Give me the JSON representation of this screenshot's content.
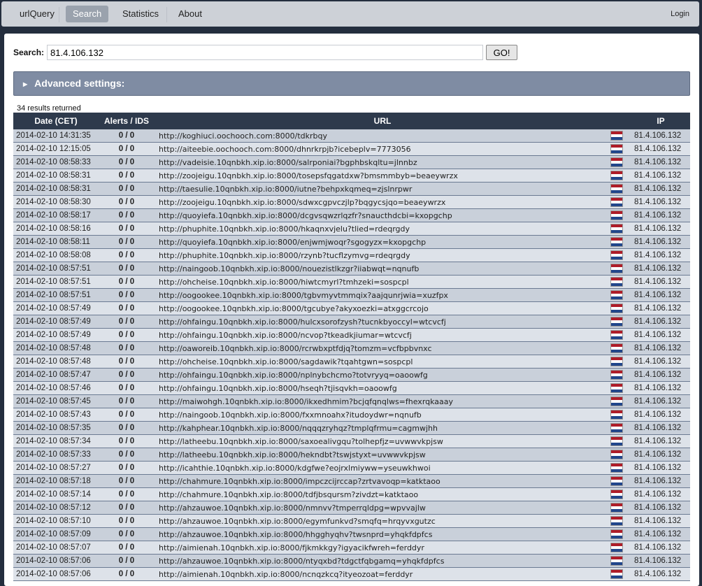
{
  "nav": {
    "brand": "urlQuery",
    "search": "Search",
    "statistics": "Statistics",
    "about": "About",
    "login": "Login"
  },
  "search": {
    "label": "Search:",
    "value": "81.4.106.132",
    "go": "GO!"
  },
  "advanced": {
    "label": "Advanced settings:"
  },
  "results_count": "34 results returned",
  "columns": [
    "Date (CET)",
    "Alerts / IDS",
    "URL",
    "IP"
  ],
  "flag_colors": [
    "#ae1c28",
    "#ffffff",
    "#21468b"
  ],
  "rows": [
    {
      "date": "2014-02-10 14:31:35",
      "alerts": "0 / 0",
      "url": "http://koghiuci.oochooch.com:8000/tdkrbqy",
      "ip": "81.4.106.132"
    },
    {
      "date": "2014-02-10 12:15:05",
      "alerts": "0 / 0",
      "url": "http://aiteebie.oochooch.com:8000/dhnrkrpjb?icebeplv=7773056",
      "ip": "81.4.106.132"
    },
    {
      "date": "2014-02-10 08:58:33",
      "alerts": "0 / 0",
      "url": "http://vadeisie.10qnbkh.xip.io:8000/salrponiai?bgphbskqltu=jlnnbz",
      "ip": "81.4.106.132"
    },
    {
      "date": "2014-02-10 08:58:31",
      "alerts": "0 / 0",
      "url": "http://zoojeigu.10qnbkh.xip.io:8000/tosepsfqgatdxw?bmsmmbyb=beaeywrzx",
      "ip": "81.4.106.132"
    },
    {
      "date": "2014-02-10 08:58:31",
      "alerts": "0 / 0",
      "url": "http://taesulie.10qnbkh.xip.io:8000/iutne?behpxkqmeq=zjslnrpwr",
      "ip": "81.4.106.132"
    },
    {
      "date": "2014-02-10 08:58:30",
      "alerts": "0 / 0",
      "url": "http://zoojeigu.10qnbkh.xip.io:8000/sdwxcgpvczjlp?bqgycsjqo=beaeywrzx",
      "ip": "81.4.106.132"
    },
    {
      "date": "2014-02-10 08:58:17",
      "alerts": "0 / 0",
      "url": "http://quoyiefa.10qnbkh.xip.io:8000/dcgvsqwzrlqzfr?snaucthdcbi=kxopgchp",
      "ip": "81.4.106.132"
    },
    {
      "date": "2014-02-10 08:58:16",
      "alerts": "0 / 0",
      "url": "http://phuphite.10qnbkh.xip.io:8000/hkaqnxvjelu?tlied=rdeqrgdy",
      "ip": "81.4.106.132"
    },
    {
      "date": "2014-02-10 08:58:11",
      "alerts": "0 / 0",
      "url": "http://quoyiefa.10qnbkh.xip.io:8000/enjwmjwoqr?sgogyzx=kxopgchp",
      "ip": "81.4.106.132"
    },
    {
      "date": "2014-02-10 08:58:08",
      "alerts": "0 / 0",
      "url": "http://phuphite.10qnbkh.xip.io:8000/rzynb?tucflzymvg=rdeqrgdy",
      "ip": "81.4.106.132"
    },
    {
      "date": "2014-02-10 08:57:51",
      "alerts": "0 / 0",
      "url": "http://naingoob.10qnbkh.xip.io:8000/nouezistlkzgr?iiabwqt=nqnufb",
      "ip": "81.4.106.132"
    },
    {
      "date": "2014-02-10 08:57:51",
      "alerts": "0 / 0",
      "url": "http://ohcheise.10qnbkh.xip.io:8000/hiwtcmyrl?tmhzeki=sospcpl",
      "ip": "81.4.106.132"
    },
    {
      "date": "2014-02-10 08:57:51",
      "alerts": "0 / 0",
      "url": "http://oogookee.10qnbkh.xip.io:8000/tgbvmyvtmmqix?aajqunrjwia=xuzfpx",
      "ip": "81.4.106.132"
    },
    {
      "date": "2014-02-10 08:57:49",
      "alerts": "0 / 0",
      "url": "http://oogookee.10qnbkh.xip.io:8000/tgcubye?akyxoezki=atxggcrcojo",
      "ip": "81.4.106.132"
    },
    {
      "date": "2014-02-10 08:57:49",
      "alerts": "0 / 0",
      "url": "http://ohfaingu.10qnbkh.xip.io:8000/hulcxsorofzysh?tucnkbyoccyl=wtcvcfj",
      "ip": "81.4.106.132"
    },
    {
      "date": "2014-02-10 08:57:49",
      "alerts": "0 / 0",
      "url": "http://ohfaingu.10qnbkh.xip.io:8000/ncvop?tkeadkjiumar=wtcvcfj",
      "ip": "81.4.106.132"
    },
    {
      "date": "2014-02-10 08:57:48",
      "alerts": "0 / 0",
      "url": "http://oaworeib.10qnbkh.xip.io:8000/rcrwbxptfdjq?tomzm=vcfbpbvnxc",
      "ip": "81.4.106.132"
    },
    {
      "date": "2014-02-10 08:57:48",
      "alerts": "0 / 0",
      "url": "http://ohcheise.10qnbkh.xip.io:8000/sagdawik?tqahtgwn=sospcpl",
      "ip": "81.4.106.132"
    },
    {
      "date": "2014-02-10 08:57:47",
      "alerts": "0 / 0",
      "url": "http://ohfaingu.10qnbkh.xip.io:8000/nplnybchcmo?totvryyq=oaoowfg",
      "ip": "81.4.106.132"
    },
    {
      "date": "2014-02-10 08:57:46",
      "alerts": "0 / 0",
      "url": "http://ohfaingu.10qnbkh.xip.io:8000/hseqh?tjisqvkh=oaoowfg",
      "ip": "81.4.106.132"
    },
    {
      "date": "2014-02-10 08:57:45",
      "alerts": "0 / 0",
      "url": "http://maiwohgh.10qnbkh.xip.io:8000/ikxedhmim?bcjqfqnqlws=fhexrqkaaay",
      "ip": "81.4.106.132"
    },
    {
      "date": "2014-02-10 08:57:43",
      "alerts": "0 / 0",
      "url": "http://naingoob.10qnbkh.xip.io:8000/fxxmnoahx?itudoydwr=nqnufb",
      "ip": "81.4.106.132"
    },
    {
      "date": "2014-02-10 08:57:35",
      "alerts": "0 / 0",
      "url": "http://kahphear.10qnbkh.xip.io:8000/nqqqzryhqz?tmplqfrmu=cagmwjhh",
      "ip": "81.4.106.132"
    },
    {
      "date": "2014-02-10 08:57:34",
      "alerts": "0 / 0",
      "url": "http://latheebu.10qnbkh.xip.io:8000/saxoealivgqu?tolhepfjz=uvwwvkpjsw",
      "ip": "81.4.106.132"
    },
    {
      "date": "2014-02-10 08:57:33",
      "alerts": "0 / 0",
      "url": "http://latheebu.10qnbkh.xip.io:8000/hekndbt?tswjstyxt=uvwwvkpjsw",
      "ip": "81.4.106.132"
    },
    {
      "date": "2014-02-10 08:57:27",
      "alerts": "0 / 0",
      "url": "http://icahthie.10qnbkh.xip.io:8000/kdgfwe?eojrxlmiyww=yseuwkhwoi",
      "ip": "81.4.106.132"
    },
    {
      "date": "2014-02-10 08:57:18",
      "alerts": "0 / 0",
      "url": "http://chahmure.10qnbkh.xip.io:8000/impczcijrccap?zrtvavoqp=katktaoo",
      "ip": "81.4.106.132"
    },
    {
      "date": "2014-02-10 08:57:14",
      "alerts": "0 / 0",
      "url": "http://chahmure.10qnbkh.xip.io:8000/tdfjbsqursm?zivdzt=katktaoo",
      "ip": "81.4.106.132"
    },
    {
      "date": "2014-02-10 08:57:12",
      "alerts": "0 / 0",
      "url": "http://ahzauwoe.10qnbkh.xip.io:8000/nmnvv?tmperrqldpg=wpvvajlw",
      "ip": "81.4.106.132"
    },
    {
      "date": "2014-02-10 08:57:10",
      "alerts": "0 / 0",
      "url": "http://ahzauwoe.10qnbkh.xip.io:8000/egymfunkvd?smqfq=hrqyvxgutzc",
      "ip": "81.4.106.132"
    },
    {
      "date": "2014-02-10 08:57:09",
      "alerts": "0 / 0",
      "url": "http://ahzauwoe.10qnbkh.xip.io:8000/hhgghyqhv?twsnprd=yhqkfdpfcs",
      "ip": "81.4.106.132"
    },
    {
      "date": "2014-02-10 08:57:07",
      "alerts": "0 / 0",
      "url": "http://aimienah.10qnbkh.xip.io:8000/fjkmkkgy?igyacikfwreh=ferddyr",
      "ip": "81.4.106.132"
    },
    {
      "date": "2014-02-10 08:57:06",
      "alerts": "0 / 0",
      "url": "http://ahzauwoe.10qnbkh.xip.io:8000/ntyqxbd?tdgctfqbgamq=yhqkfdpfcs",
      "ip": "81.4.106.132"
    },
    {
      "date": "2014-02-10 08:57:06",
      "alerts": "0 / 0",
      "url": "http://aimienah.10qnbkh.xip.io:8000/ncnqzkcq?ityeozoat=ferddyr",
      "ip": "81.4.106.132"
    }
  ]
}
